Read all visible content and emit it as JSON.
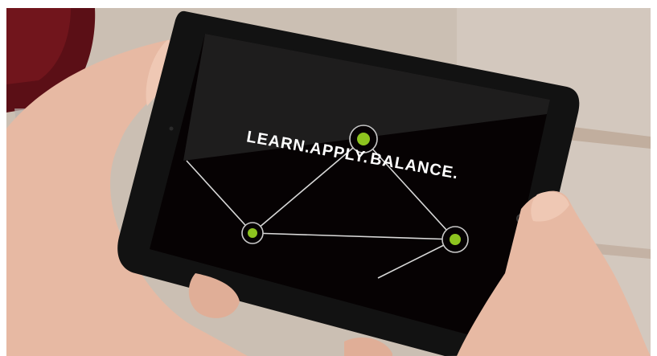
{
  "screen": {
    "tagline_word_1": "LEARN.",
    "tagline_word_2": "APPLY.",
    "tagline_word_3": "BALANCE."
  },
  "colors": {
    "node_fill": "#8dc41f",
    "line": "#d8d8d8",
    "screen_bg": "#060203",
    "bezel": "#111111"
  },
  "icons": [
    "network-node-icon"
  ]
}
